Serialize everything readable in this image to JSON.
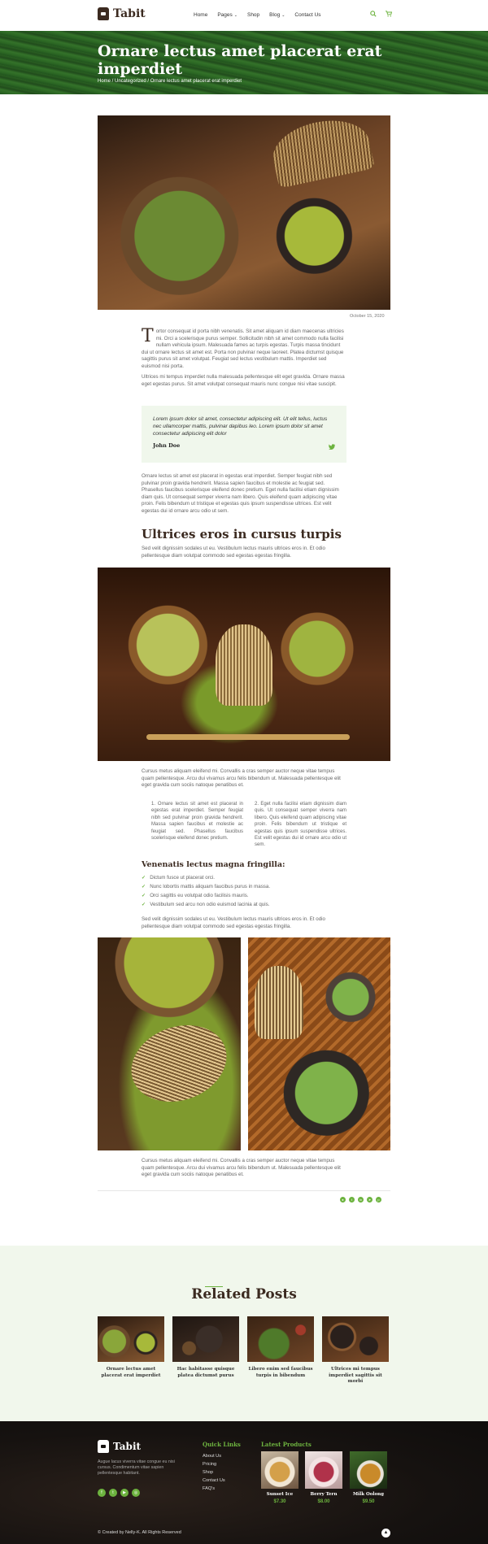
{
  "header": {
    "logo_text": "Tabit",
    "nav": [
      {
        "label": "Home",
        "dropdown": false
      },
      {
        "label": "Pages",
        "dropdown": true
      },
      {
        "label": "Shop",
        "dropdown": false
      },
      {
        "label": "Blog",
        "dropdown": true
      },
      {
        "label": "Contact Us",
        "dropdown": false
      }
    ],
    "search_icon": "search-icon",
    "cart_icon": "cart-icon",
    "caret": "⌄"
  },
  "banner": {
    "title": "Ornare lectus amet placerat erat imperdiet",
    "breadcrumb": "Home / Uncategorized / Ornare lectus amet placerat erat imperdiet"
  },
  "post": {
    "date": "October 15, 2020",
    "intro_dropcap": "T",
    "intro": "ortor consequat id porta nibh venenatis. Sit amet aliquam id diam maecenas ultricies mi. Orci a scelerisque purus semper. Sollicitudin nibh sit amet commodo nulla facilisi nullam vehicula ipsum. Malesuada fames ac turpis egestas. Turpis massa tincidunt dui ut ornare lectus sit amet est. Porta non pulvinar neque laoreet. Platea dictumst quisque sagittis purus sit amet volutpat. Feugiat sed lectus vestibulum mattis. Imperdiet sed euismod nisi porta.",
    "para2": "Ultrices mi tempus imperdiet nulla malesuada pellentesque elit eget gravida. Ornare massa eget egestas purus. Sit amet volutpat consequat mauris nunc congue nisi vitae suscipit.",
    "quote": {
      "text": "Lorem ipsum dolor sit amet, consectetur adipiscing elit. Ut elit tellus, luctus nec ullamcorper mattis, pulvinar dapibus leo. Lorem ipsum dolor sit amet consectetur adipiscing elit dolor",
      "author": "John Doe"
    },
    "para3": "Ornare lectus sit amet est placerat in egestas erat imperdiet. Semper feugiat nibh sed pulvinar proin gravida hendrerit. Massa sapien faucibus et molestie ac feugiat sed. Phasellus faucibus scelerisque eleifend donec pretium. Eget nulla facilisi etiam dignissim diam quis. Ut consequat semper viverra nam libero. Quis eleifend quam adipiscing vitae proin. Felis bibendum ut tristique et egestas quis ipsum suspendisse ultrices. Est velit egestas dui id ornare arcu odio ut sem.",
    "h2": "Ultrices eros in cursus turpis",
    "para4": "Sed velit dignissim sodales ut eu. Vestibulum lectus mauris ultrices eros in. Et odio pellentesque diam volutpat commodo sed egestas egestas fringilla.",
    "para5": "Cursus metus aliquam eleifend mi. Convallis a cras semper auctor neque vitae tempus quam pellentesque. Arcu dui vivamus arcu felis bibendum ut. Malesuada pellentesque elit eget gravida cum sociis natoque penatibus et.",
    "col1": "1. Ornare lectus sit amet est placerat in egestas erat imperdiet. Semper feugiat nibh sed pulvinar proin gravida hendrerit. Massa sapien faucibus et molestie ac feugiat sed. Phasellus faucibus scelerisque eleifend donec pretium.",
    "col2": "2. Eget nulla facilisi etiam dignissim diam quis. Ut consequat semper viverra nam libero. Quis eleifend quam adipiscing vitae proin. Felis bibendum ut tristique et egestas quis ipsum suspendisse ultrices. Est velit egestas dui id ornare arcu odio ut sem.",
    "h3": "Venenatis lectus magna fringilla:",
    "checklist": [
      "Dictum fusce ut placerat orci.",
      "Nunc lobortis mattis aliquam faucibus purus in massa.",
      "Orci sagittis eu volutpat odio facilisis mauris.",
      "Vestibulum sed arcu non odio euismod lacinia at quis."
    ],
    "para6": "Sed velit dignissim sodales ut eu. Vestibulum lectus mauris ultrices eros in. Et odio pellentesque diam volutpat commodo sed egestas egestas fringilla.",
    "para7": "Cursus metus aliquam eleifend mi. Convallis a cras semper auctor neque vitae tempus quam pellentesque. Arcu dui vivamus arcu felis bibendum ut. Malesuada pellentesque elit eget gravida cum sociis natoque penatibus et.",
    "share_icons": [
      "whatsapp-icon",
      "twitter-icon",
      "linkedin-icon",
      "telegram-icon",
      "pinterest-icon"
    ]
  },
  "related": {
    "title": "Related Posts",
    "items": [
      "Ornare lectus amet placerat erat imperdiet",
      "Hac habitasse quisque platea dictumst purus",
      "Libero enim sed faucibus turpis in bibendum",
      "Ultrices mi tempus imperdiet sagittis sit morbi"
    ]
  },
  "footer": {
    "logo_text": "Tabit",
    "about": "Augue lacus viverra vitae congue eu nisi cursus. Condimentum vitae sapien pellentesque habitant.",
    "social": [
      "facebook-icon",
      "twitter-icon",
      "youtube-icon",
      "instagram-icon"
    ],
    "quick_links_title": "Quick Links",
    "quick_links": [
      "About Us",
      "Pricing",
      "Shop",
      "Contact Us",
      "FAQ's"
    ],
    "latest_title": "Latest Products",
    "products": [
      {
        "name": "Sunset Ice",
        "price": "$7.30"
      },
      {
        "name": "Berry Tern",
        "price": "$8.00"
      },
      {
        "name": "Milk Oolong",
        "price": "$9.50"
      }
    ],
    "copyright": "© Created by Nelly-K. All Rights Reserved",
    "to_top_icon": "arrow-up-icon"
  },
  "colors": {
    "accent": "#6db33f",
    "brown": "#3b2a20",
    "quote_bg": "#f0f7ec",
    "footer_bg": "#161210"
  }
}
